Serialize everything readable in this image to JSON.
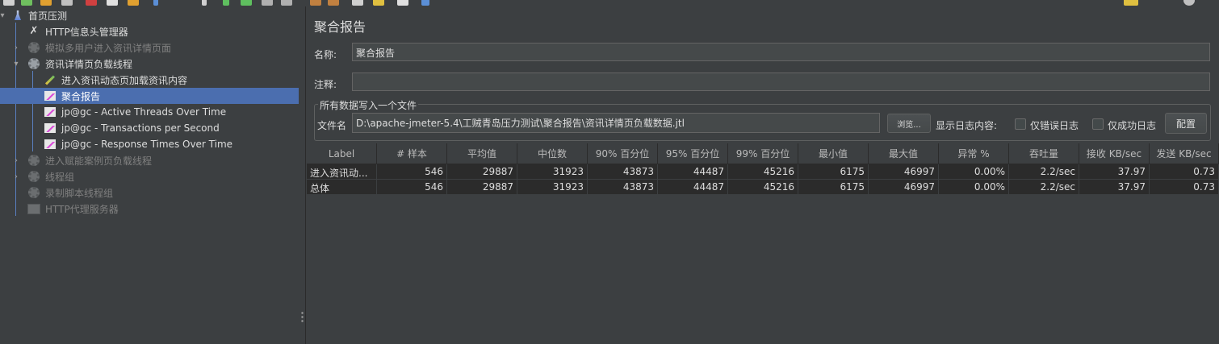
{
  "tree": {
    "items": [
      {
        "label": "首页压测",
        "icon": "test-plan-icon",
        "state": "normal"
      },
      {
        "label": "HTTP信息头管理器",
        "icon": "tools-icon",
        "state": "normal"
      },
      {
        "label": "模拟多用户进入资讯详情页面",
        "icon": "gear-icon",
        "state": "disabled"
      },
      {
        "label": "资讯详情页负载线程",
        "icon": "gear-icon",
        "state": "normal"
      },
      {
        "label": "进入资讯动态页加载资讯内容",
        "icon": "sampler-icon",
        "state": "normal"
      },
      {
        "label": "聚合报告",
        "icon": "listener-icon",
        "state": "selected"
      },
      {
        "label": "jp@gc - Active Threads Over Time",
        "icon": "listener-icon",
        "state": "normal"
      },
      {
        "label": "jp@gc - Transactions per Second",
        "icon": "listener-icon",
        "state": "normal"
      },
      {
        "label": "jp@gc - Response Times Over Time",
        "icon": "listener-icon",
        "state": "normal"
      },
      {
        "label": "进入赋能案例页负载线程",
        "icon": "gear-icon",
        "state": "disabled"
      },
      {
        "label": "线程组",
        "icon": "gear-icon",
        "state": "disabled"
      },
      {
        "label": "录制脚本线程组",
        "icon": "gear-icon",
        "state": "disabled"
      },
      {
        "label": "HTTP代理服务器",
        "icon": "proxy-icon",
        "state": "disabled"
      }
    ]
  },
  "panel": {
    "title": "聚合报告",
    "name_label": "名称:",
    "name_value": "聚合报告",
    "comment_label": "注释:",
    "comment_value": "",
    "group_title": "所有数据写入一个文件",
    "file_label": "文件名",
    "file_value": "D:\\apache-jmeter-5.4\\工贼青岛压力测试\\聚合报告\\资讯详情页负载数据.jtl",
    "browse_label": "浏览...",
    "log_label": "显示日志内容:",
    "errors_only_label": "仅错误日志",
    "success_only_label": "仅成功日志",
    "config_label": "配置"
  },
  "table": {
    "headers": [
      "Label",
      "# 样本",
      "平均值",
      "中位数",
      "90% 百分位",
      "95% 百分位",
      "99% 百分位",
      "最小值",
      "最大值",
      "异常 %",
      "吞吐量",
      "接收 KB/sec",
      "发送 KB/sec"
    ],
    "rows": [
      [
        "进入资讯动...",
        "546",
        "29887",
        "31923",
        "43873",
        "44487",
        "45216",
        "6175",
        "46997",
        "0.00%",
        "2.2/sec",
        "37.97",
        "0.73"
      ],
      [
        "总体",
        "546",
        "29887",
        "31923",
        "43873",
        "44487",
        "45216",
        "6175",
        "46997",
        "0.00%",
        "2.2/sec",
        "37.97",
        "0.73"
      ]
    ]
  }
}
